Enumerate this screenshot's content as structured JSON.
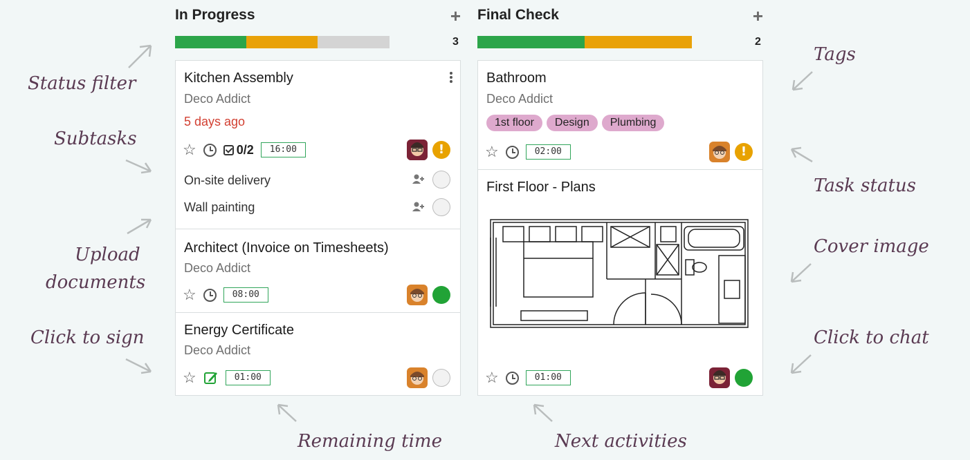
{
  "annotations": {
    "status_filter": "Status filter",
    "subtasks": "Subtasks",
    "upload_documents_line1": "Upload",
    "upload_documents_line2": "documents",
    "click_to_sign": "Click to sign",
    "remaining_time": "Remaining time",
    "next_activities": "Next activities",
    "tags": "Tags",
    "task_status": "Task status",
    "cover_image": "Cover image",
    "click_to_chat": "Click to chat"
  },
  "columns": [
    {
      "title": "In Progress",
      "add_symbol": "+",
      "count": "3",
      "progress": [
        {
          "color": "#2ca54a",
          "fraction": 0.333
        },
        {
          "color": "#e9a209",
          "fraction": 0.333
        },
        {
          "color": "#d4d4d4",
          "fraction": 0.334
        }
      ],
      "cards": [
        {
          "title": "Kitchen Assembly",
          "customer": "Deco Addict",
          "date": "5 days ago",
          "subtask_count": "0/2",
          "time": "16:00",
          "status": "warning",
          "subtasks": [
            "On-site delivery",
            "Wall painting"
          ]
        },
        {
          "title": "Architect (Invoice on Timesheets)",
          "customer": "Deco Addict",
          "time": "08:00",
          "status": "done"
        },
        {
          "title": "Energy Certificate",
          "customer": "Deco Addict",
          "time": "01:00",
          "status": "normal"
        }
      ]
    },
    {
      "title": "Final Check",
      "add_symbol": "+",
      "count": "2",
      "progress": [
        {
          "color": "#2ca54a",
          "fraction": 0.5
        },
        {
          "color": "#e9a209",
          "fraction": 0.5
        }
      ],
      "cards": [
        {
          "title": "Bathroom",
          "customer": "Deco Addict",
          "tags": [
            "1st floor",
            "Design",
            "Plumbing"
          ],
          "time": "02:00",
          "status": "warning"
        },
        {
          "title": "First Floor - Plans",
          "time": "01:00",
          "status": "done"
        }
      ]
    }
  ],
  "warning_symbol": "!",
  "colors": {
    "green": "#21a336",
    "orange": "#e8a200",
    "tag": "#dea9cd",
    "annotation": "#5a3a52",
    "overdue": "#d23f31"
  }
}
